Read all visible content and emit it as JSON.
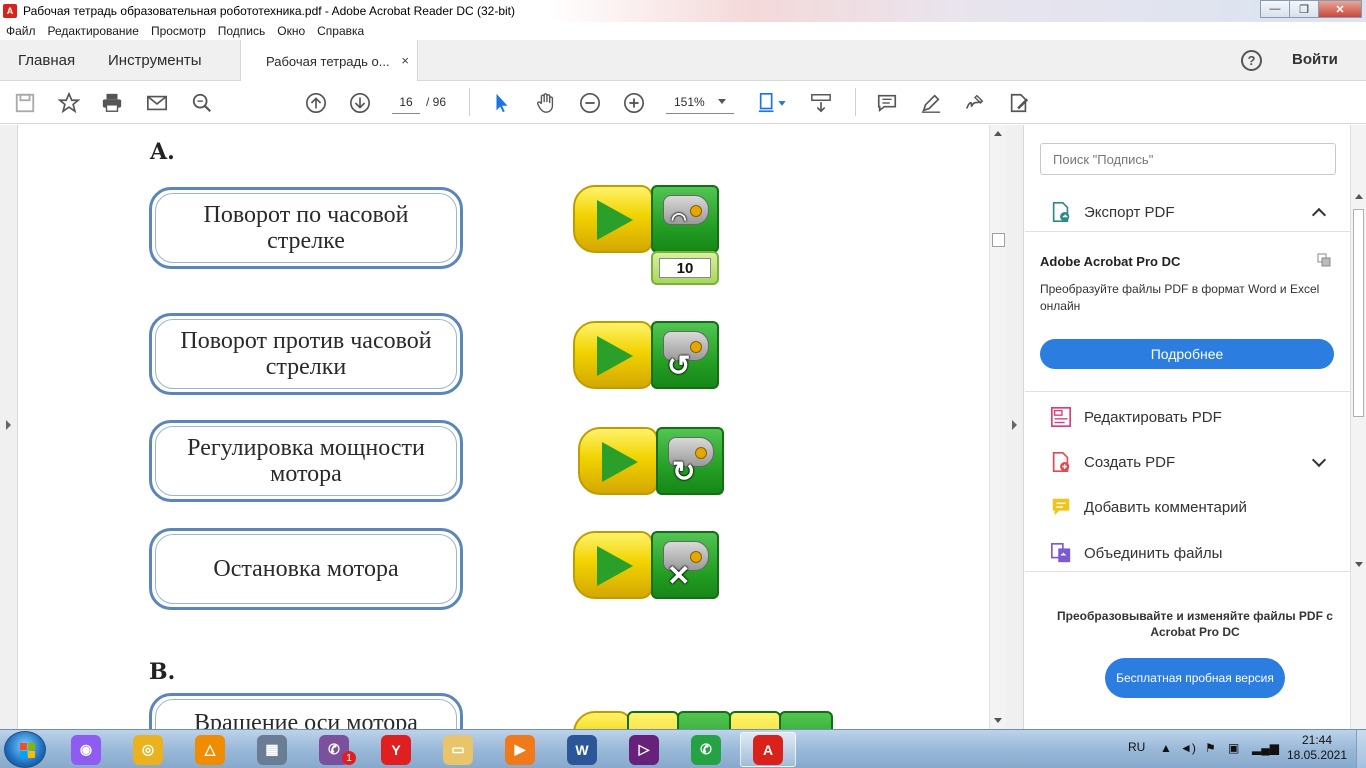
{
  "window": {
    "title": "Рабочая тетрадь образовательная робототехника.pdf - Adobe Acrobat Reader DC (32-bit)",
    "app_icon_letter": "A"
  },
  "menu": [
    "Файл",
    "Редактирование",
    "Просмотр",
    "Подпись",
    "Окно",
    "Справка"
  ],
  "tabs": {
    "home": "Главная",
    "tools": "Инструменты",
    "document": "Рабочая тетрадь о...",
    "close_glyph": "×"
  },
  "header": {
    "help_glyph": "?",
    "signin": "Войти"
  },
  "toolbar": {
    "page_current": "16",
    "page_total": "/ 96",
    "zoom": "151%"
  },
  "document": {
    "section_a": "A.",
    "section_b": "B.",
    "commands": [
      {
        "text": "Поворот по часовой стрелке",
        "icon": "motor-speed-dial-icon",
        "glyph": ""
      },
      {
        "text": "Поворот против часовой стрелки",
        "icon": "counterclockwise-arrow-icon",
        "glyph": "↺"
      },
      {
        "text": "Регулировка мощности мотора",
        "icon": "clockwise-arrow-icon",
        "glyph": "↻"
      },
      {
        "text": "Остановка мотора",
        "icon": "stop-x-icon",
        "glyph": "✕"
      }
    ],
    "number_block_value": "10",
    "next_command": "Вращение оси мотора"
  },
  "right_panel": {
    "search_placeholder": "Поиск \"Подпись\"",
    "export_pdf": "Экспорт PDF",
    "promo_title": "Adobe Acrobat Pro DC",
    "promo_desc": "Преобразуйте файлы PDF в формат Word и Excel онлайн",
    "more_button": "Подробнее",
    "tools": [
      {
        "label": "Редактировать PDF",
        "icon": "edit-pdf-icon",
        "color": "#e0397a"
      },
      {
        "label": "Создать PDF",
        "icon": "create-pdf-icon",
        "color": "#e34850"
      },
      {
        "label": "Добавить комментарий",
        "icon": "comment-icon",
        "color": "#f0c419"
      },
      {
        "label": "Объединить файлы",
        "icon": "combine-files-icon",
        "color": "#7a5ad6"
      }
    ],
    "bottom_promo": "Преобразовывайте и изменяйте файлы PDF с Acrobat Pro DC",
    "trial_button": "Бесплатная пробная версия"
  },
  "taskbar": {
    "apps": [
      {
        "name": "alice-icon",
        "color": "#8e5cf0",
        "glyph": "◉"
      },
      {
        "name": "chrome-icon",
        "color": "#e9b21e",
        "glyph": "◎"
      },
      {
        "name": "avast-icon",
        "color": "#f08c00",
        "glyph": "△"
      },
      {
        "name": "calculator-icon",
        "color": "#6a7d94",
        "glyph": "▦"
      },
      {
        "name": "viber-icon",
        "color": "#7b519d",
        "glyph": "✆"
      },
      {
        "name": "yandex-browser-icon",
        "color": "#e02020",
        "glyph": "Y"
      },
      {
        "name": "file-explorer-icon",
        "color": "#e8c46a",
        "glyph": "▭"
      },
      {
        "name": "media-player-icon",
        "color": "#f07a1a",
        "glyph": "▶"
      },
      {
        "name": "word-icon",
        "color": "#2b579a",
        "glyph": "W"
      },
      {
        "name": "visual-studio-icon",
        "color": "#68217a",
        "glyph": "▷"
      },
      {
        "name": "whatsapp-icon",
        "color": "#25a244",
        "glyph": "✆"
      },
      {
        "name": "acrobat-icon",
        "color": "#d8221b",
        "glyph": "A"
      }
    ],
    "viber_badge": "1",
    "language": "RU",
    "time": "21:44",
    "date": "18.05.2021"
  }
}
